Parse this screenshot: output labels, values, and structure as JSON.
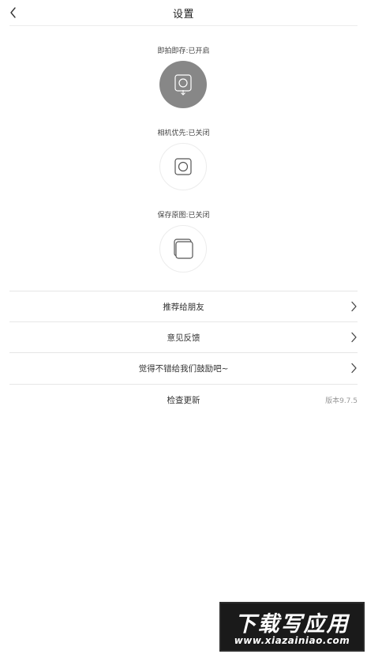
{
  "header": {
    "title": "设置"
  },
  "toggles": [
    {
      "label": "即拍即存:已开启",
      "state": "on"
    },
    {
      "label": "相机优先:已关闭",
      "state": "off"
    },
    {
      "label": "保存原图:已关闭",
      "state": "off"
    }
  ],
  "menu": {
    "items": [
      {
        "label": "推荐给朋友"
      },
      {
        "label": "意见反馈"
      },
      {
        "label": "觉得不错给我们鼓励吧~"
      }
    ],
    "update": {
      "label": "检查更新",
      "version": "版本9.7.5"
    }
  },
  "watermark": {
    "main": "下载写应用",
    "url": "www.xiazainiao.com"
  },
  "colors": {
    "toggle_on": "#878787",
    "divider": "#e6e6e6"
  }
}
